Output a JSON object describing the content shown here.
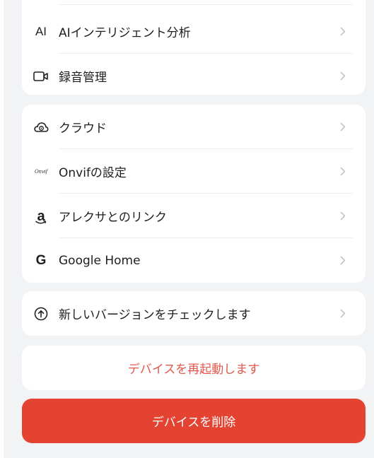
{
  "group1": {
    "items": [
      {
        "label": "AIインテリジェント分析",
        "icon": "ai-icon",
        "icon_text": "AI"
      },
      {
        "label": "録音管理",
        "icon": "video-camera-icon"
      }
    ]
  },
  "group2": {
    "items": [
      {
        "label": "クラウド",
        "icon": "cloud-play-icon"
      },
      {
        "label": "Onvifの設定",
        "icon": "onvif-icon",
        "icon_text": "Onvif"
      },
      {
        "label": "アレクサとのリンク",
        "icon": "amazon-alexa-icon",
        "icon_text": "a"
      },
      {
        "label": "Google Home",
        "icon": "google-icon",
        "icon_text": "G"
      }
    ]
  },
  "group3": {
    "items": [
      {
        "label": "新しいバージョンをチェックします",
        "icon": "upgrade-arrow-icon"
      }
    ]
  },
  "restart": {
    "label": "デバイスを再起動します"
  },
  "delete": {
    "label": "デバイスを削除"
  },
  "colors": {
    "background": "#f2f3f5",
    "card": "#ffffff",
    "danger": "#e44332",
    "danger_text": "#e2574c",
    "chevron": "#c4c4c6"
  }
}
